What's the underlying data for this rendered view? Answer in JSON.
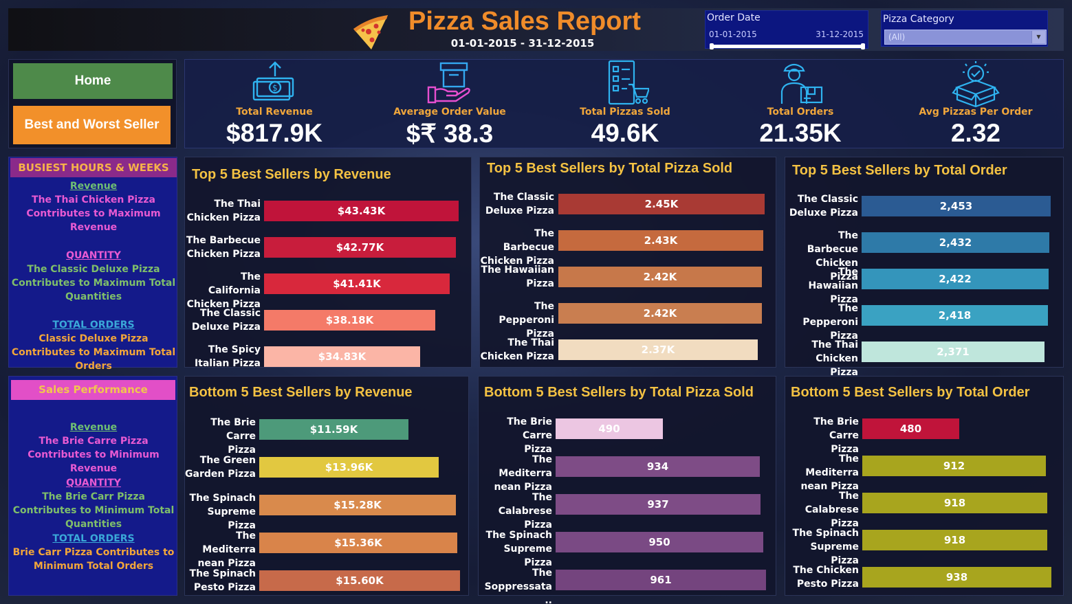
{
  "header": {
    "title": "Pizza Sales Report",
    "date_range": "01-01-2015 - 31-12-2015",
    "logo_icon": "pizza-slice-icon"
  },
  "filters": {
    "order_date": {
      "label": "Order Date",
      "start": "01-01-2015",
      "end": "31-12-2015"
    },
    "pizza_category": {
      "label": "Pizza Category",
      "value": "(All)"
    }
  },
  "nav": {
    "home": "Home",
    "best_worst": "Best and Worst Seller"
  },
  "kpis": [
    {
      "label": "Total Revenue",
      "value": "$817.9K",
      "icon": "money-upload-icon"
    },
    {
      "label": "Average Order Value",
      "value": "$₹ 38.3",
      "icon": "hand-box-icon"
    },
    {
      "label": "Total Pizzas Sold",
      "value": "49.6K",
      "icon": "checklist-cart-icon"
    },
    {
      "label": "Total Orders",
      "value": "21.35K",
      "icon": "delivery-man-icon"
    },
    {
      "label": "Avg Pizzas Per Order",
      "value": "2.32",
      "icon": "box-check-icon"
    }
  ],
  "busiest": {
    "heading": "BUSIEST HOURS & WEEKS",
    "revenue_label": "Revenue",
    "revenue_text": "The Thai Chicken Pizza Contributes to Maximum Revenue",
    "quantity_label": "QUANTITY",
    "quantity_text": "The Classic Deluxe Pizza Contributes to Maximum Total Quantities",
    "orders_label": "TOTAL ORDERS",
    "orders_text": "Classic Deluxe Pizza Contributes to Maximum Total Orders"
  },
  "sales_performance": {
    "heading": "Sales Performance",
    "revenue_label": "Revenue",
    "revenue_text": "The Brie Carre Pizza Contributes to Minimum Revenue",
    "quantity_label": "QUANTITY",
    "quantity_text": "The Brie Carr Pizza Contributes to Minimum Total Quantities",
    "orders_label": "TOTAL ORDERS",
    "orders_text": "Brie Carr Pizza Contributes to Minimum Total Orders"
  },
  "chart_data": [
    {
      "type": "bar",
      "title": "Top 5 Best Sellers by Revenue",
      "categories": [
        "The Thai Chicken Pizza",
        "The Barbecue Chicken Pizza",
        "The California Chicken Pizza",
        "The Classic Deluxe Pizza",
        "The Spicy Italian Pizza"
      ],
      "category_lines": [
        [
          "The Thai",
          "Chicken Pizza"
        ],
        [
          "The Barbecue",
          "Chicken Pizza"
        ],
        [
          "The California",
          "Chicken Pizza"
        ],
        [
          "The Classic",
          "Deluxe Pizza"
        ],
        [
          "The Spicy",
          "Italian Pizza"
        ]
      ],
      "values": [
        43430,
        42770,
        41410,
        38180,
        34830
      ],
      "labels": [
        "$43.43K",
        "$42.77K",
        "$41.41K",
        "$38.18K",
        "$34.83K"
      ],
      "colors": [
        "#c0143a",
        "#c81d3c",
        "#d8283c",
        "#f47a68",
        "#fbb5a6"
      ]
    },
    {
      "type": "bar",
      "title": "Top 5 Best Sellers by Total Pizza Sold",
      "categories": [
        "The Classic Deluxe Pizza",
        "The Barbecue Chicken Pizza",
        "The Hawaiian Pizza",
        "The Pepperoni Pizza",
        "The Thai Chicken Pizza"
      ],
      "category_lines": [
        [
          "The Classic",
          "Deluxe Pizza"
        ],
        [
          "The Barbecue",
          "Chicken Pizza"
        ],
        [
          "The Hawaiian",
          "Pizza"
        ],
        [
          "The Pepperoni",
          "Pizza"
        ],
        [
          "The Thai",
          "Chicken Pizza"
        ]
      ],
      "values": [
        2450,
        2430,
        2420,
        2420,
        2370
      ],
      "labels": [
        "2.45K",
        "2.43K",
        "2.42K",
        "2.42K",
        "2.37K"
      ],
      "colors": [
        "#a93a34",
        "#c56a3e",
        "#c7784a",
        "#c97e50",
        "#f1dcc0"
      ]
    },
    {
      "type": "bar",
      "title": "Top 5 Best Sellers by Total Order",
      "categories": [
        "The Classic Deluxe Pizza",
        "The Barbecue Chicken Pizza",
        "The Hawaiian Pizza",
        "The Pepperoni Pizza",
        "The Thai Chicken Pizza"
      ],
      "category_lines": [
        [
          "The Classic",
          "Deluxe Pizza"
        ],
        [
          "The Barbecue",
          "Chicken Pizza"
        ],
        [
          "The Hawaiian",
          "Pizza"
        ],
        [
          "The Pepperoni",
          "Pizza"
        ],
        [
          "The Thai",
          "Chicken Pizza"
        ]
      ],
      "values": [
        2453,
        2432,
        2422,
        2418,
        2371
      ],
      "labels": [
        "2,453",
        "2,432",
        "2,422",
        "2,418",
        "2,371"
      ],
      "colors": [
        "#2b5b93",
        "#2e7aa8",
        "#3495bb",
        "#3aa2c2",
        "#bfe6dc"
      ]
    },
    {
      "type": "bar",
      "title": "Bottom 5 Best Sellers by Revenue",
      "categories": [
        "The Brie Carre Pizza",
        "The Green Garden Pizza",
        "The Spinach Supreme Pizza",
        "The Mediterranean Pizza",
        "The Spinach Pesto Pizza"
      ],
      "category_lines": [
        [
          "The Brie Carre",
          "Pizza"
        ],
        [
          "The Green",
          "Garden Pizza"
        ],
        [
          "The Spinach",
          "Supreme Pizza"
        ],
        [
          "The Mediterra",
          "nean Pizza"
        ],
        [
          "The Spinach",
          "Pesto Pizza"
        ]
      ],
      "values": [
        11590,
        13960,
        15280,
        15360,
        15600
      ],
      "labels": [
        "$11.59K",
        "$13.96K",
        "$15.28K",
        "$15.36K",
        "$15.60K"
      ],
      "colors": [
        "#4d9a7a",
        "#e2c840",
        "#d98a4c",
        "#d9844a",
        "#c76a4a"
      ]
    },
    {
      "type": "bar",
      "title": "Bottom 5 Best Sellers by Total Pizza Sold",
      "categories": [
        "The Brie Carre Pizza",
        "The Mediterranean Pizza",
        "The Calabrese Pizza",
        "The Spinach Supreme Pizza",
        "The Soppressata .."
      ],
      "category_lines": [
        [
          "The Brie Carre",
          "Pizza"
        ],
        [
          "The Mediterra",
          "nean Pizza"
        ],
        [
          "The Calabrese",
          "Pizza"
        ],
        [
          "The Spinach",
          "Supreme Pizza"
        ],
        [
          "The",
          "Soppressata .."
        ]
      ],
      "values": [
        490,
        934,
        937,
        950,
        961
      ],
      "labels": [
        "490",
        "934",
        "937",
        "950",
        "961"
      ],
      "colors": [
        "#ecc6e2",
        "#7e4c86",
        "#7e4c86",
        "#7a4a84",
        "#74447e"
      ]
    },
    {
      "type": "bar",
      "title": "Bottom 5 Best Sellers by Total Order",
      "categories": [
        "The Brie Carre Pizza",
        "The Mediterranean Pizza",
        "The Calabrese Pizza",
        "The Spinach Supreme Pizza",
        "The Chicken Pesto Pizza"
      ],
      "category_lines": [
        [
          "The Brie Carre",
          "Pizza"
        ],
        [
          "The Mediterra",
          "nean Pizza"
        ],
        [
          "The Calabrese",
          "Pizza"
        ],
        [
          "The Spinach",
          "Supreme Pizza"
        ],
        [
          "The Chicken",
          "Pesto Pizza"
        ]
      ],
      "values": [
        480,
        912,
        918,
        918,
        938
      ],
      "labels": [
        "480",
        "912",
        "918",
        "918",
        "938"
      ],
      "colors": [
        "#c0143a",
        "#a8a51e",
        "#a8a51e",
        "#a8a51e",
        "#a8a51e"
      ]
    }
  ]
}
